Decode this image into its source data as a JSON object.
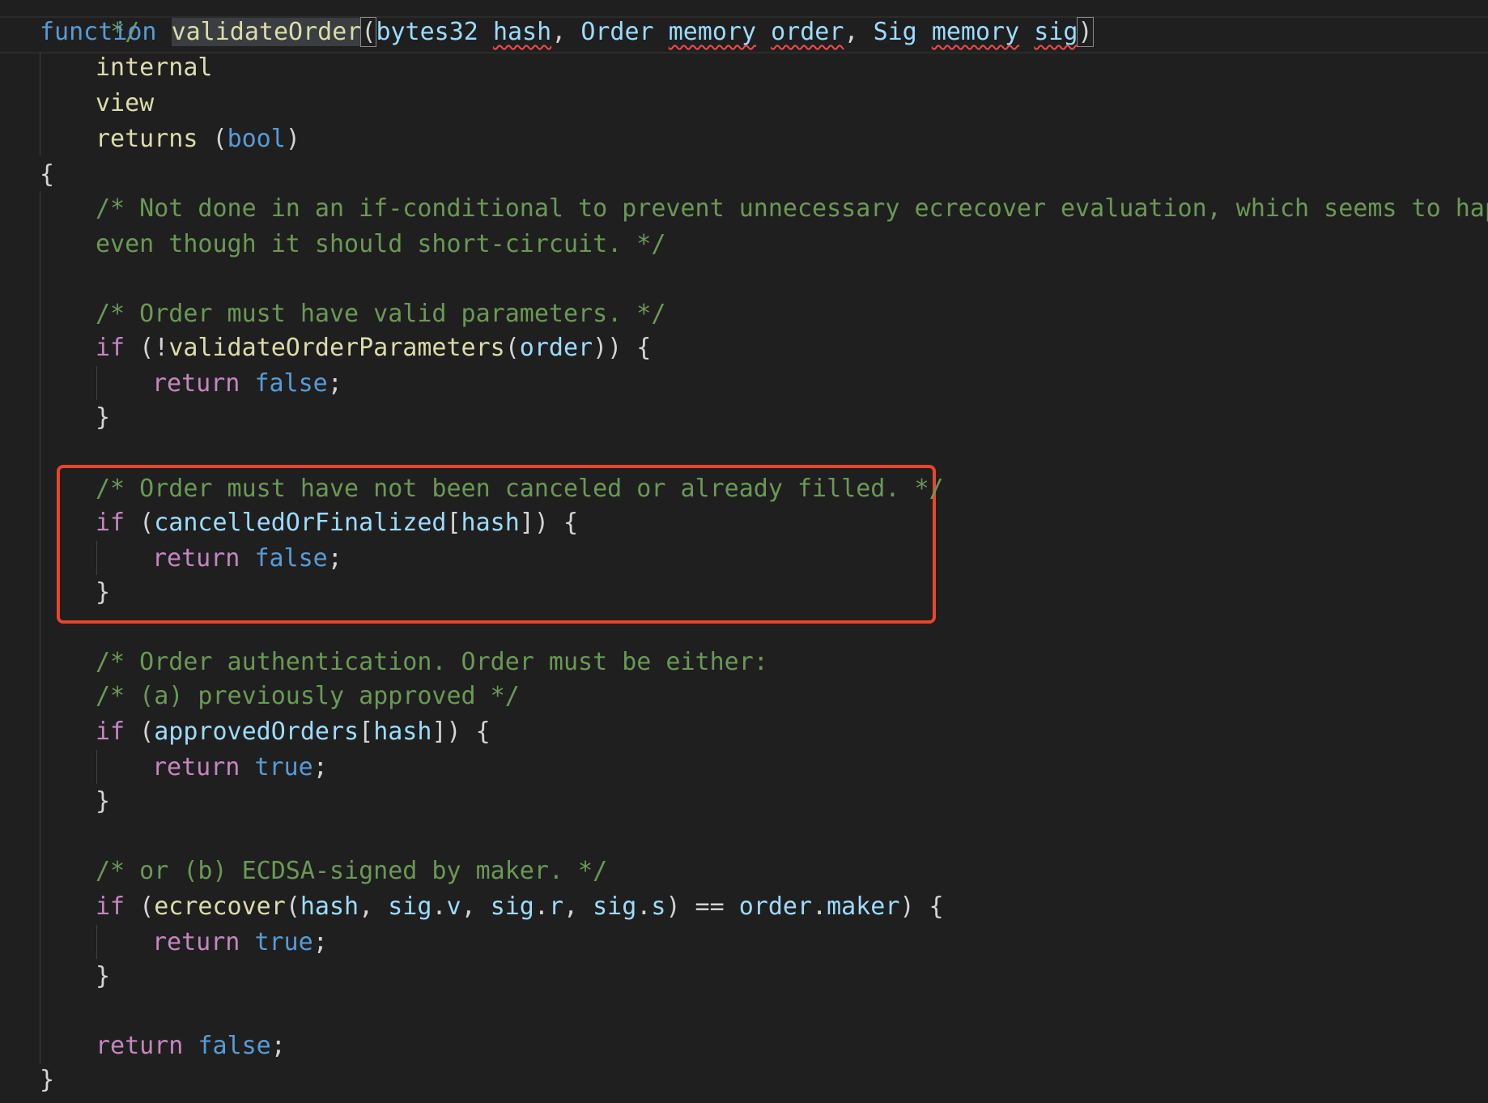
{
  "code": {
    "top_fragment": "*/",
    "signature": {
      "kw_function": "function",
      "name": "validateOrder",
      "open_paren": "(",
      "p1_type": "bytes32",
      "p1_name": "hash",
      "comma1": ", ",
      "p2_type": "Order",
      "p2_loc": "memory",
      "p2_name": "order",
      "comma2": ", ",
      "p3_type": "Sig",
      "p3_loc": "memory",
      "p3_name": "sig",
      "close_paren": ")"
    },
    "mod_internal": "internal",
    "mod_view": "view",
    "returns_kw": "returns",
    "returns_open": " (",
    "returns_type": "bool",
    "returns_close": ")",
    "open_brace": "{",
    "comment1a": "/* Not done in an if-conditional to prevent unnecessary ecrecover evaluation, which seems to happen",
    "comment1b": "even though it should short-circuit. */",
    "comment2": "/* Order must have valid parameters. */",
    "if1": {
      "kw": "if",
      "pre": " (!",
      "fn": "validateOrderParameters",
      "p": "(",
      "arg": "order",
      "post": ")) {"
    },
    "ret1": {
      "kw": "return",
      "val": "false",
      "semi": ";"
    },
    "close1": "}",
    "comment3": "/* Order must have not been canceled or already filled. */",
    "if2": {
      "kw": "if",
      "pre": " (",
      "id": "cancelledOrFinalized",
      "b1": "[",
      "arg": "hash",
      "post": "]) {"
    },
    "ret2": {
      "kw": "return",
      "val": "false",
      "semi": ";"
    },
    "close2": "}",
    "comment4": "/* Order authentication. Order must be either:",
    "comment5": "/* (a) previously approved */",
    "if3": {
      "kw": "if",
      "pre": " (",
      "id": "approvedOrders",
      "b1": "[",
      "arg": "hash",
      "post": "]) {"
    },
    "ret3": {
      "kw": "return",
      "val": "true",
      "semi": ";"
    },
    "close3": "}",
    "comment6": "/* or (b) ECDSA-signed by maker. */",
    "if4": {
      "kw": "if",
      "pre": " (",
      "fn": "ecrecover",
      "p": "(",
      "a1": "hash",
      "c1": ", ",
      "a2o": "sig",
      "d1": ".",
      "a2p": "v",
      "c2": ", ",
      "a3o": "sig",
      "d2": ".",
      "a3p": "r",
      "c3": ", ",
      "a4o": "sig",
      "d3": ".",
      "a4p": "s",
      "eq": ") == ",
      "a5o": "order",
      "d4": ".",
      "a5p": "maker",
      "post": ") {"
    },
    "ret4": {
      "kw": "return",
      "val": "true",
      "semi": ";"
    },
    "close4": "}",
    "ret5": {
      "kw": "return",
      "val": "false",
      "semi": ";"
    },
    "close_fn": "}"
  },
  "colors": {
    "background": "#1f1f1f",
    "highlight_border": "#e8452c",
    "comment": "#6a9955",
    "keyword": "#569cd6",
    "control": "#c586c0",
    "identifier": "#9cdcfe",
    "function": "#dcdcaa"
  }
}
